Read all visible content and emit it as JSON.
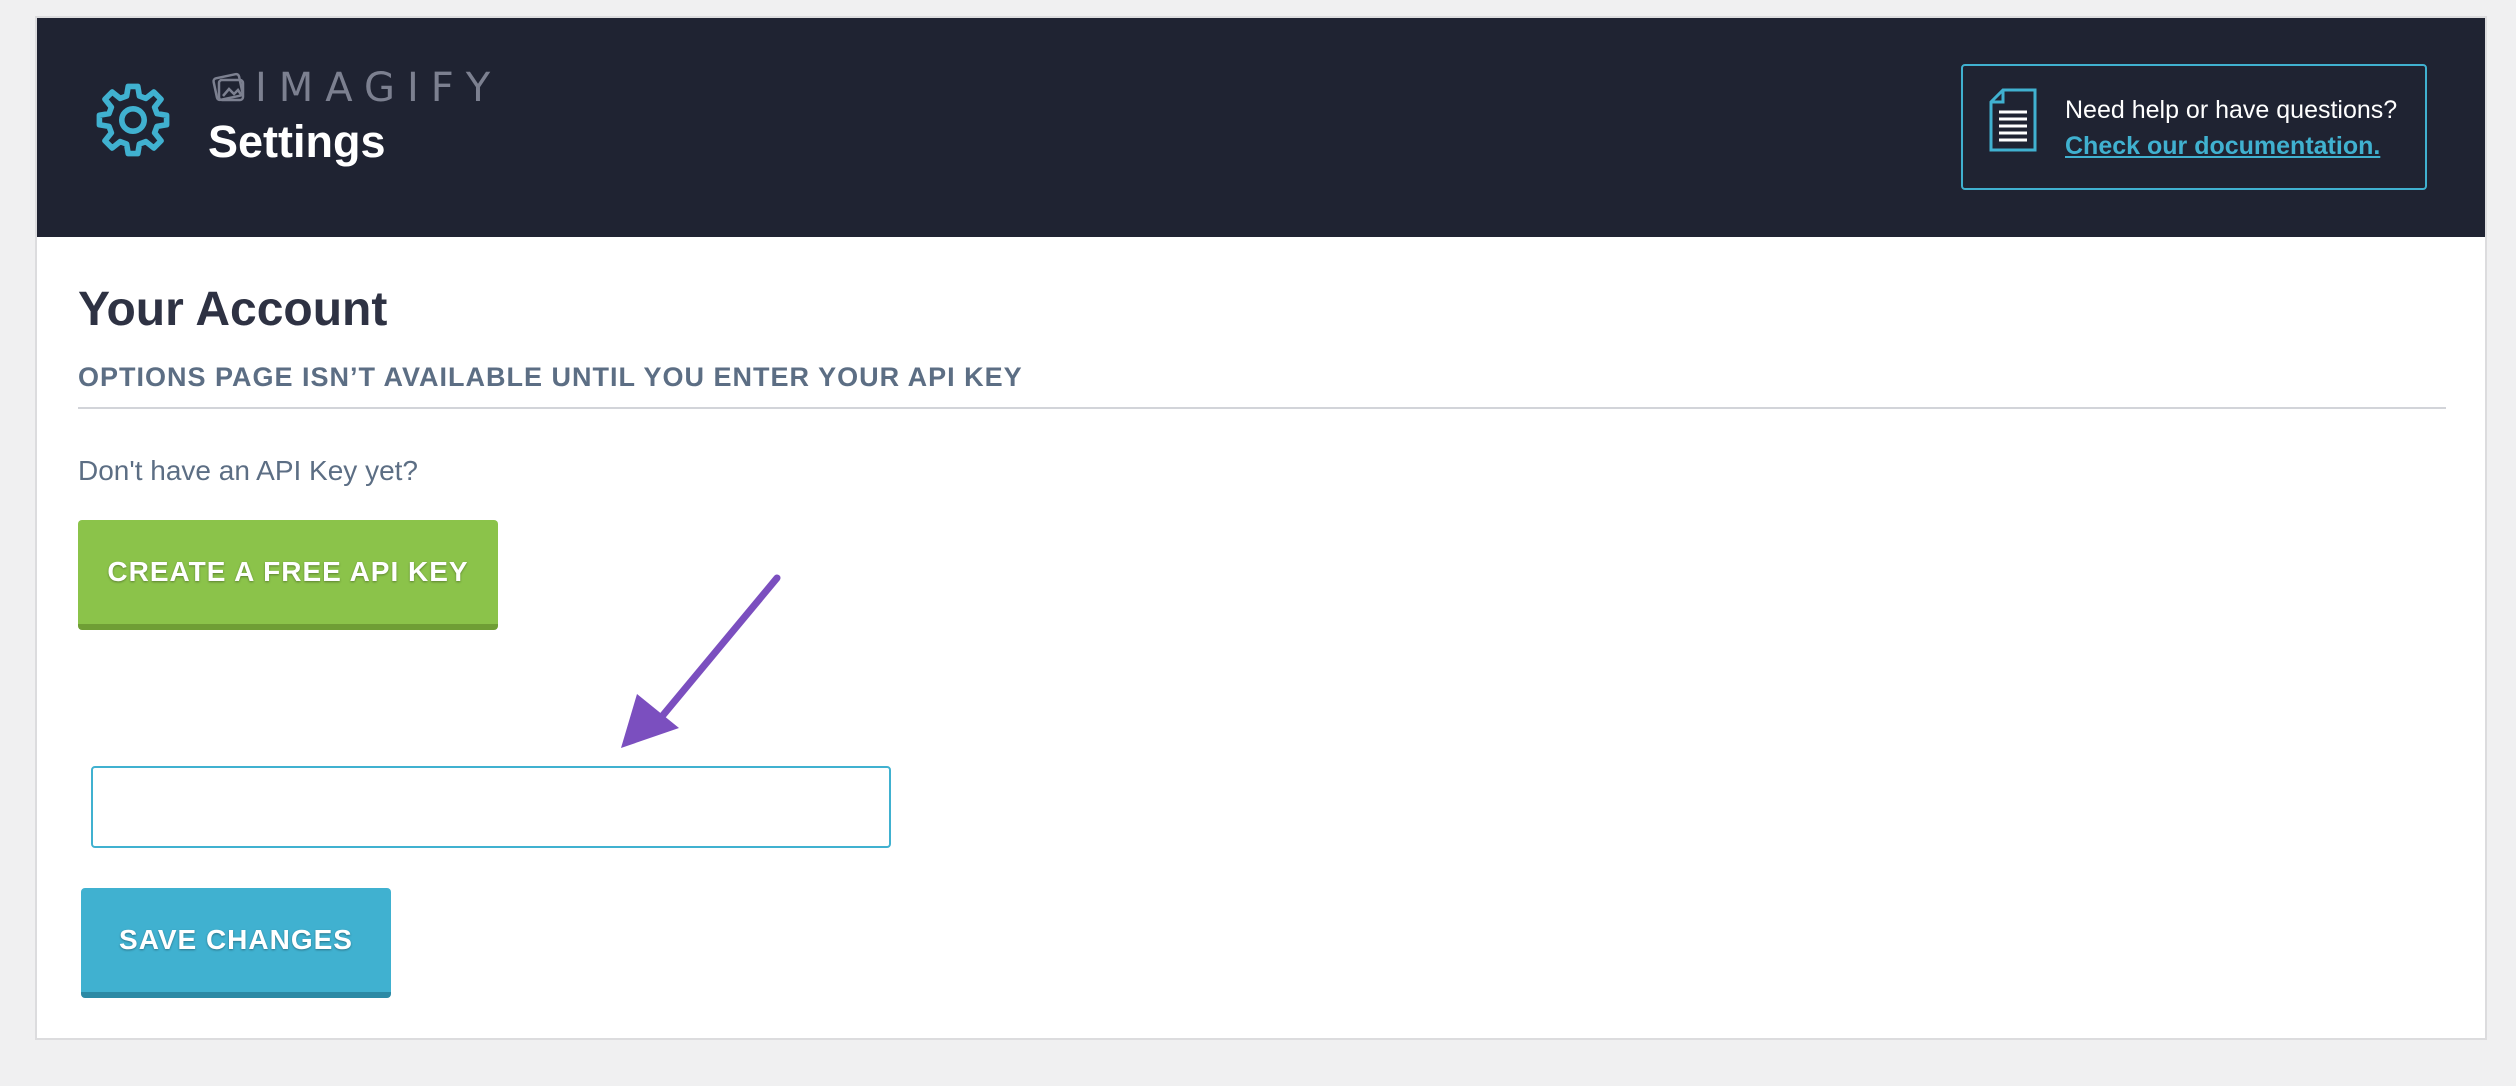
{
  "colors": {
    "header_bg": "#1f2332",
    "accent_blue": "#40b1d0",
    "accent_green": "#8bc34a",
    "annotation_arrow": "#7b4fbf",
    "subtitle_text": "#5c6e84",
    "title_text": "#2e3243"
  },
  "header": {
    "icon": "gear-icon",
    "brand": "IMAGIFY",
    "page_title": "Settings",
    "help": {
      "icon": "document-icon",
      "question": "Need help or have questions?",
      "link_label": "Check our documentation."
    }
  },
  "account": {
    "title": "Your Account",
    "subtitle": "OPTIONS PAGE ISN’T AVAILABLE UNTIL YOU ENTER YOUR API KEY",
    "prompt": "Don't have an API Key yet?",
    "create_button_label": "CREATE A FREE API KEY",
    "api_key_input": {
      "value": "",
      "placeholder": ""
    },
    "save_button_label": "SAVE CHANGES"
  },
  "annotation": {
    "icon": "arrow-down-left-icon"
  }
}
